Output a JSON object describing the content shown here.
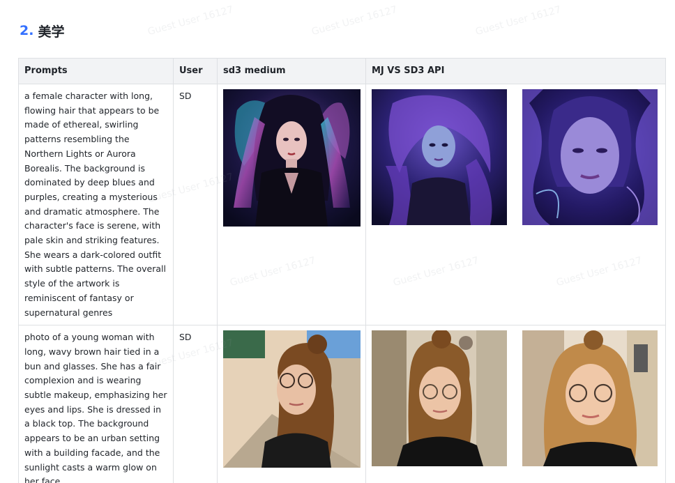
{
  "section": {
    "number": "2.",
    "title": "美学"
  },
  "table": {
    "headers": [
      "Prompts",
      "User",
      "sd3 medium",
      "MJ VS SD3 API"
    ],
    "rows": [
      {
        "prompt": "a female character with long, flowing hair that appears to be made of ethereal, swirling patterns resembling the Northern Lights or Aurora Borealis. The background is dominated by deep blues and purples, creating a mysterious and dramatic atmosphere. The character's face is serene, with pale skin and striking features. She wears a dark-colored outfit with subtle patterns. The overall style of the artwork is reminiscent of fantasy or supernatural genres",
        "user": "SD"
      },
      {
        "prompt": "photo of a young woman with long, wavy brown hair tied in a bun and glasses. She has a fair complexion and is wearing subtle makeup, emphasizing her eyes and lips. She is dressed in a black top. The background appears to be an urban setting with a building facade, and the sunlight casts a warm glow on her face",
        "user": "SD"
      }
    ]
  },
  "watermark": "Guest User 16127",
  "colors": {
    "accent": "#3370ff",
    "header_bg": "#f2f3f5",
    "border": "#dee0e3"
  }
}
